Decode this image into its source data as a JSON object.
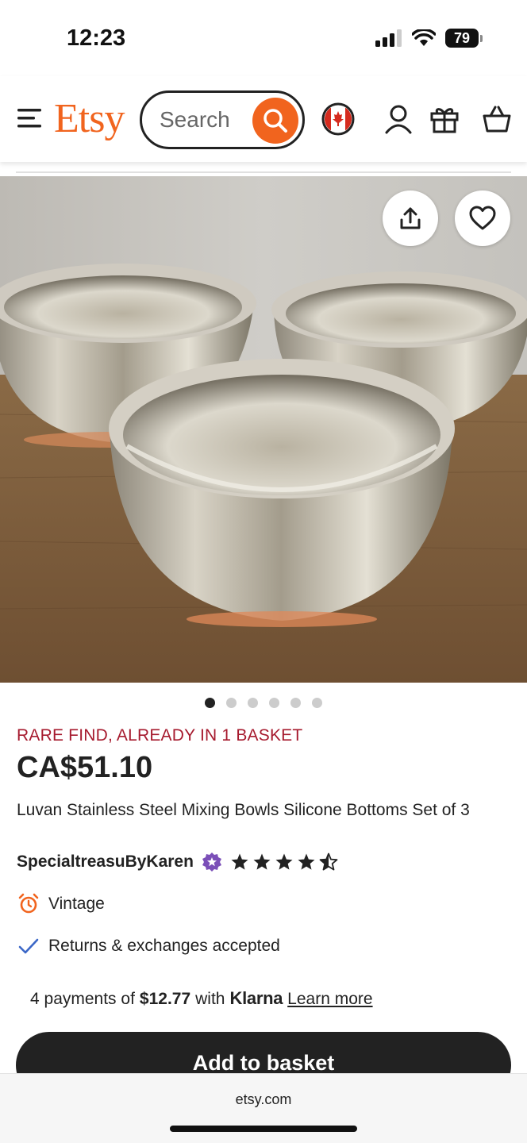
{
  "status_bar": {
    "time": "12:23",
    "battery": "79"
  },
  "header": {
    "logo": "Etsy",
    "search_placeholder": "Search"
  },
  "product": {
    "badge": "RARE FIND, ALREADY IN 1 BASKET",
    "price": "CA$51.10",
    "title": "Luvan Stainless Steel Mixing Bowls Silicone Bottoms Set of 3",
    "shop_name": "SpecialtreasuByKaren",
    "rating": 4.5,
    "image_count": 6,
    "active_image": 1
  },
  "features": {
    "vintage": "Vintage",
    "returns": "Returns & exchanges accepted"
  },
  "klarna": {
    "prefix": "4 payments of",
    "amount": "$12.77",
    "with": "with",
    "brand": "Klarna",
    "link": "Learn more"
  },
  "add_to_basket": "Add to basket",
  "browser": {
    "url": "etsy.com"
  },
  "colors": {
    "brand": "#F1641E",
    "badge": "#A61A2E",
    "button": "#222222"
  }
}
